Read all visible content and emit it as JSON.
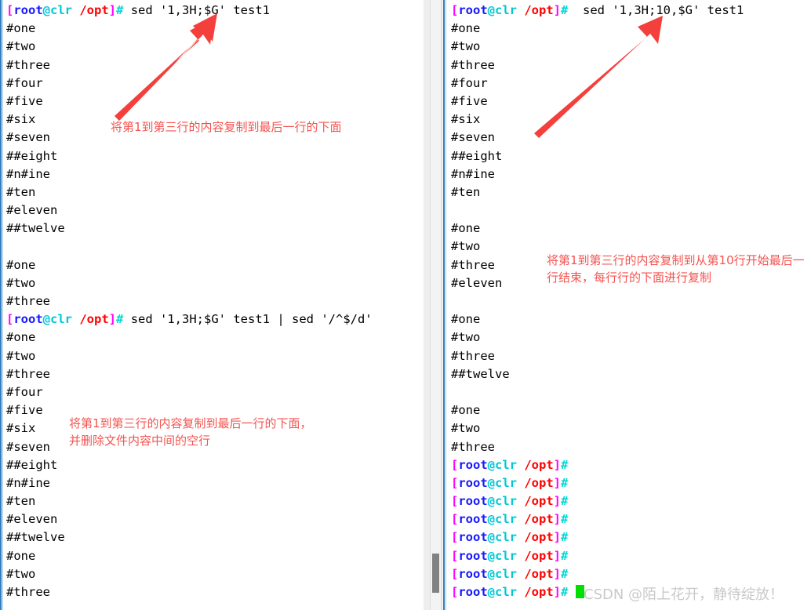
{
  "prompt": {
    "open_bracket": "[",
    "user": "root",
    "at_host": "@clr",
    "path": " /opt",
    "close_bracket": "]",
    "hash": "#"
  },
  "left_panel": {
    "name": "left-terminal",
    "blocks": [
      {
        "type": "command",
        "text": " sed '1,3H;$G' test1"
      },
      {
        "type": "output",
        "lines": [
          "#one",
          "#two",
          "#three",
          "#four",
          "#five",
          "#six",
          "#seven",
          "##eight",
          "#n#ine",
          "#ten",
          "#eleven",
          "##twelve",
          "",
          "#one",
          "#two",
          "#three"
        ]
      },
      {
        "type": "command",
        "text": " sed '1,3H;$G' test1 | sed '/^$/d'"
      },
      {
        "type": "output",
        "lines": [
          "#one",
          "#two",
          "#three",
          "#four",
          "#five",
          "#six",
          "#seven",
          "##eight",
          "#n#ine",
          "#ten",
          "#eleven",
          "##twelve",
          "#one",
          "#two",
          "#three"
        ]
      }
    ],
    "annotations": [
      {
        "id": "annot-left-1",
        "text": "将第1到第三行的内容复制到最后一行的下面"
      },
      {
        "id": "annot-left-2",
        "text": "将第1到第三行的内容复制到最后一行的下面，并删除文件内容中间的空行"
      }
    ]
  },
  "right_panel": {
    "name": "right-terminal",
    "blocks": [
      {
        "type": "command",
        "text": "  sed '1,3H;10,$G' test1"
      },
      {
        "type": "output",
        "lines": [
          "#one",
          "#two",
          "#three",
          "#four",
          "#five",
          "#six",
          "#seven",
          "##eight",
          "#n#ine",
          "#ten",
          "",
          "#one",
          "#two",
          "#three",
          "#eleven",
          "",
          "#one",
          "#two",
          "#three",
          "##twelve",
          "",
          "#one",
          "#two",
          "#three"
        ]
      },
      {
        "type": "prompt_only",
        "count": 8
      }
    ],
    "annotations": [
      {
        "id": "annot-right-1",
        "text": "将第1到第三行的内容复制到从第10行开始最后一行结束，每行行的下面进行复制"
      }
    ],
    "cursor_visible": true
  },
  "arrows": [
    {
      "id": "arrow-left",
      "name": "red-arrow-left",
      "points_to": "1,3H;$G"
    },
    {
      "id": "arrow-right",
      "name": "red-arrow-right",
      "points_to": "1,3H;10,$G"
    }
  ],
  "watermark": {
    "text": "CSDN @陌上花开，静待绽放！"
  },
  "colors": {
    "prompt_bracket": "#ff00ff",
    "prompt_user": "#1818ff",
    "prompt_host": "#00c8d7",
    "prompt_path": "#ff0000",
    "prompt_hash": "#00d7d7",
    "annotation": "#f4534f",
    "cursor": "#00e000",
    "panel_border": "#2f7fc1",
    "watermark": "#c9c9c9"
  },
  "scrollbar": {
    "name": "vertical-scrollbar",
    "thumb_position": "bottom"
  }
}
